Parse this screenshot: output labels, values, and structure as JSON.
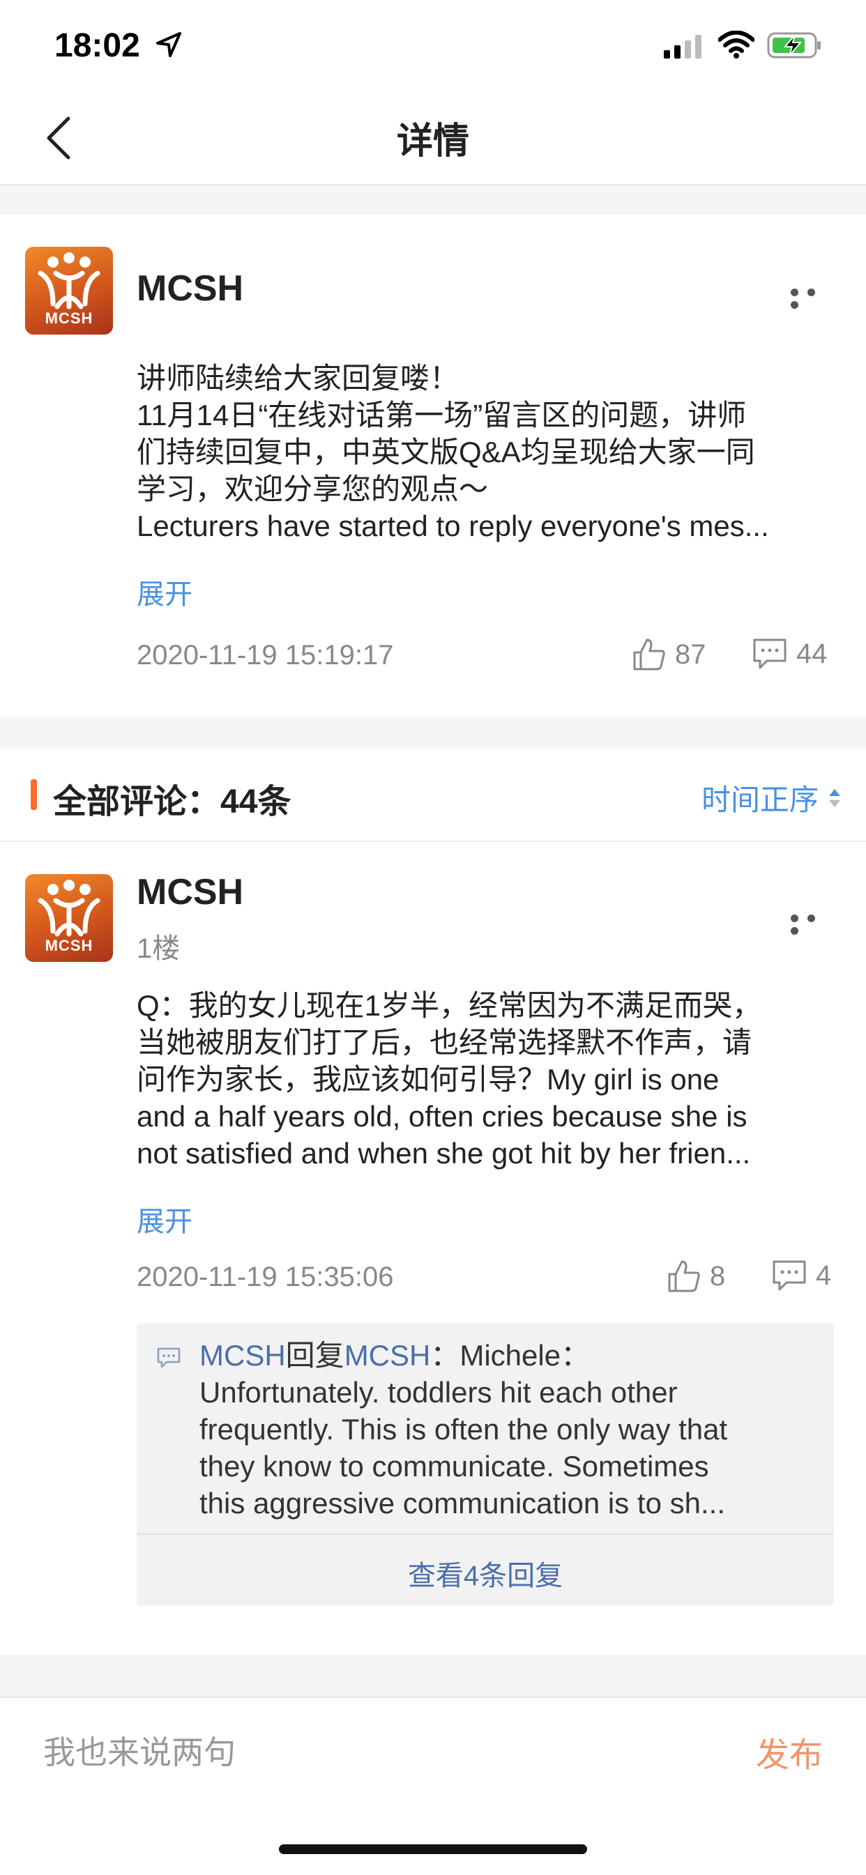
{
  "status": {
    "time": "18:02"
  },
  "nav": {
    "title": "详情"
  },
  "post": {
    "author": "MCSH",
    "avatar_text": "MCSH",
    "lines": [
      "讲师陆续给大家回复喽！",
      "11月14日“在线对话第一场”留言区的问题，讲师",
      "们持续回复中，中英文版Q&A均呈现给大家一同",
      "学习，欢迎分享您的观点～",
      "Lecturers have started to reply everyone's mes..."
    ],
    "expand": "展开",
    "time": "2020-11-19 15:19:17",
    "likes": "87",
    "comments": "44"
  },
  "comments_section": {
    "title": "全部评论：44条",
    "sort": "时间正序"
  },
  "comment": {
    "author": "MCSH",
    "avatar_text": "MCSH",
    "floor": "1楼",
    "lines": [
      "Q：我的女儿现在1岁半，经常因为不满足而哭，",
      "当她被朋友们打了后，也经常选择默不作声，请",
      "问作为家长，我应该如何引导？My girl is one",
      "and a half years old, often cries because she is",
      "not satisfied and when she got hit by her frien..."
    ],
    "expand": "展开",
    "time": "2020-11-19 15:35:06",
    "likes": "8",
    "comments": "4",
    "reply": {
      "from": "MCSH",
      "verb": "回复",
      "to": "MCSH",
      "first_line": "：Michele：",
      "lines": [
        "Unfortunately. toddlers hit each other",
        "frequently. This is often the only way that",
        "they know to communicate.  Sometimes",
        "this aggressive communication is to sh..."
      ],
      "view_more": "查看4条回复"
    }
  },
  "bottom": {
    "placeholder": "我也来说两句",
    "publish": "发布"
  },
  "colors": {
    "accent_blue": "#4a90e2",
    "accent_orange": "#ff6a2a",
    "publish": "#f0956a"
  }
}
